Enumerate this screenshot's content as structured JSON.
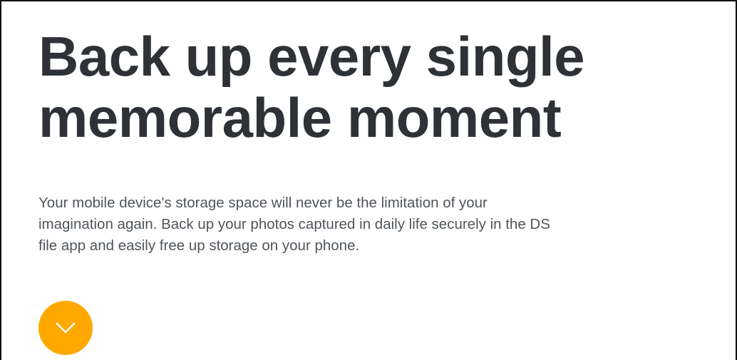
{
  "hero": {
    "headline_lines": [
      "Back up every single",
      "memorable moment"
    ],
    "description_lines": [
      "Your mobile device's storage space will never be the limitation of your",
      "imagination again. Back up your photos captured in daily life securely in the DS",
      "file app and easily free up storage on your phone."
    ],
    "scroll_button": {
      "icon": "chevron-down-icon",
      "color": "#ffa800"
    }
  },
  "colors": {
    "headline": "#2e3236",
    "body_text": "#50555a",
    "accent": "#ffa800",
    "background": "#ffffff"
  }
}
